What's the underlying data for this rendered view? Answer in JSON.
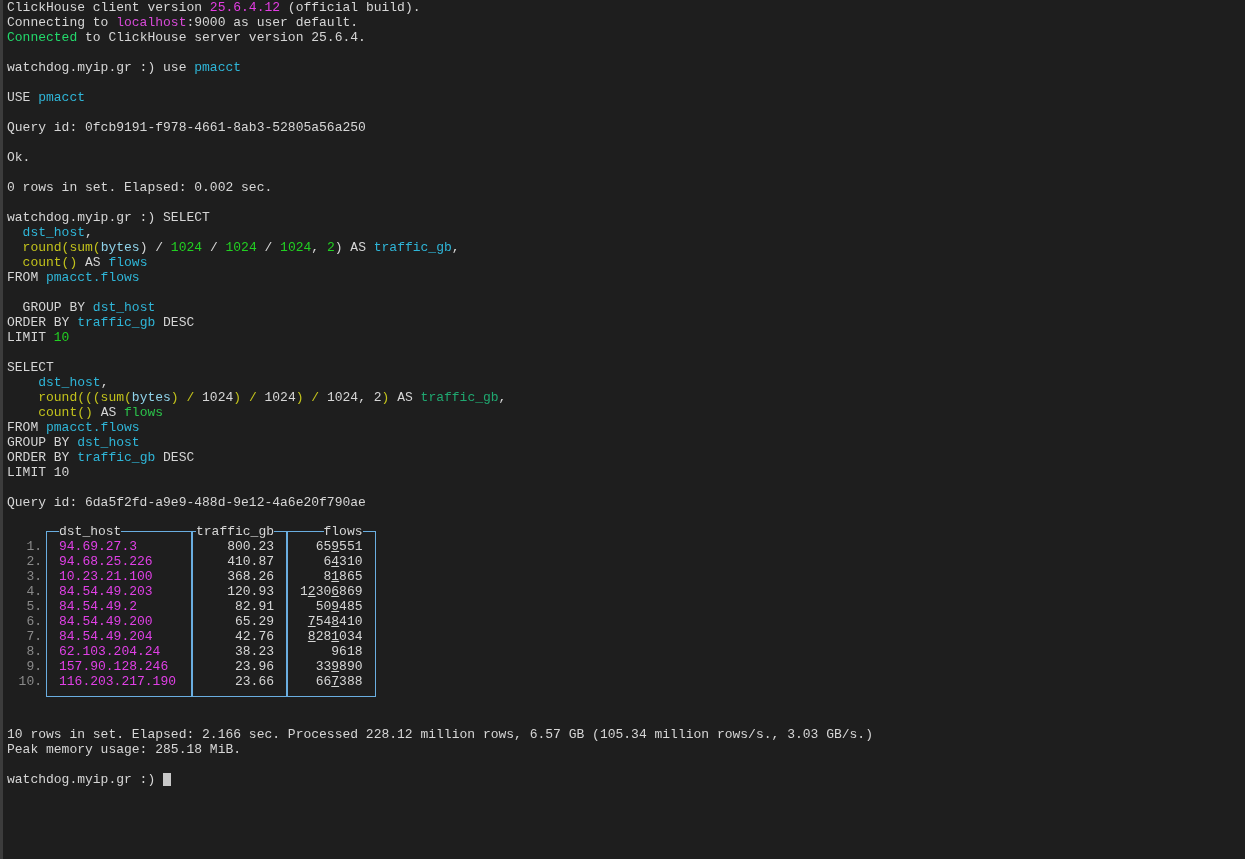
{
  "terminal": {
    "lines_before": [
      {
        "kind": "text",
        "segments": [
          {
            "text": "ClickHouse client version "
          },
          {
            "text": "25.6.4.12",
            "color": "#e23de2"
          },
          {
            "text": " (official build)."
          }
        ]
      },
      {
        "kind": "text",
        "segments": [
          {
            "text": "Connecting to "
          },
          {
            "text": "localhost",
            "color": "#d84ad8"
          },
          {
            "text": ":9000 as user default."
          }
        ]
      },
      {
        "kind": "text",
        "segments": [
          {
            "text": "Connected",
            "color": "#23d86b"
          },
          {
            "text": " to ClickHouse server version 25.6.4."
          }
        ]
      },
      {
        "kind": "blank"
      },
      {
        "kind": "text",
        "segments": [
          {
            "text": "watchdog.myip.gr :) use "
          },
          {
            "text": "pmacct",
            "color": "#2fb6d8"
          }
        ]
      },
      {
        "kind": "blank"
      },
      {
        "kind": "text",
        "segments": [
          {
            "text": "USE "
          },
          {
            "text": "pmacct",
            "color": "#2fb6d8"
          }
        ]
      },
      {
        "kind": "blank"
      },
      {
        "kind": "text",
        "segments": [
          {
            "text": "Query id: 0fcb9191-f978-4661-8ab3-52805a56a250"
          }
        ]
      },
      {
        "kind": "blank"
      },
      {
        "kind": "text",
        "segments": [
          {
            "text": "Ok."
          }
        ]
      },
      {
        "kind": "blank"
      },
      {
        "kind": "text",
        "segments": [
          {
            "text": "0 rows in set. Elapsed: 0.002 sec."
          }
        ]
      },
      {
        "kind": "blank"
      },
      {
        "kind": "text",
        "segments": [
          {
            "text": "watchdog.myip.gr :) SELECT"
          }
        ]
      },
      {
        "kind": "text",
        "segments": [
          {
            "text": "  dst_host",
            "color": "#2fb6d8"
          },
          {
            "text": ","
          }
        ]
      },
      {
        "kind": "text",
        "segments": [
          {
            "text": "  round(sum(",
            "color": "#c2c21c"
          },
          {
            "text": "bytes",
            "color": "#8fd3ea"
          },
          {
            "text": ") / "
          },
          {
            "text": "1024",
            "color": "#22d022"
          },
          {
            "text": " / "
          },
          {
            "text": "1024",
            "color": "#22d022"
          },
          {
            "text": " / "
          },
          {
            "text": "1024",
            "color": "#22d022"
          },
          {
            "text": ", "
          },
          {
            "text": "2",
            "color": "#22d022"
          },
          {
            "text": ") AS "
          },
          {
            "text": "traffic_gb",
            "color": "#2fb6d8"
          },
          {
            "text": ","
          }
        ]
      },
      {
        "kind": "text",
        "segments": [
          {
            "text": "  count()",
            "color": "#c2c21c"
          },
          {
            "text": " AS "
          },
          {
            "text": "flows",
            "color": "#2fb6d8"
          }
        ]
      },
      {
        "kind": "text",
        "segments": [
          {
            "text": "FROM "
          },
          {
            "text": "pmacct.flows",
            "color": "#2fb6d8"
          }
        ]
      },
      {
        "kind": "blank"
      },
      {
        "kind": "text",
        "segments": [
          {
            "text": "  GROUP BY "
          },
          {
            "text": "dst_host",
            "color": "#2fb6d8"
          }
        ]
      },
      {
        "kind": "text",
        "segments": [
          {
            "text": "ORDER BY "
          },
          {
            "text": "traffic_gb",
            "color": "#2fb6d8"
          },
          {
            "text": " DESC"
          }
        ]
      },
      {
        "kind": "text",
        "segments": [
          {
            "text": "LIMIT "
          },
          {
            "text": "10",
            "color": "#22d022"
          }
        ]
      },
      {
        "kind": "blank"
      },
      {
        "kind": "text",
        "segments": [
          {
            "text": "SELECT"
          }
        ]
      },
      {
        "kind": "text",
        "segments": [
          {
            "text": "    dst_host",
            "color": "#2fb6d8"
          },
          {
            "text": ","
          }
        ]
      },
      {
        "kind": "text",
        "segments": [
          {
            "text": "    round(((sum(",
            "color": "#c2c21c"
          },
          {
            "text": "bytes",
            "color": "#8fd3ea"
          },
          {
            "text": ") / ",
            "color": "#c2c21c"
          },
          {
            "text": "1024"
          },
          {
            "text": ") / ",
            "color": "#c2c21c"
          },
          {
            "text": "1024"
          },
          {
            "text": ") / ",
            "color": "#c2c21c"
          },
          {
            "text": "1024, 2"
          },
          {
            "text": ")",
            "color": "#c2c21c"
          },
          {
            "text": " AS "
          },
          {
            "text": "traffic_gb",
            "color": "#1fa870"
          },
          {
            "text": ","
          }
        ]
      },
      {
        "kind": "text",
        "segments": [
          {
            "text": "    count()",
            "color": "#c2c21c"
          },
          {
            "text": " AS "
          },
          {
            "text": "flows",
            "color": "#2bc24a"
          }
        ]
      },
      {
        "kind": "text",
        "segments": [
          {
            "text": "FROM "
          },
          {
            "text": "pmacct.flows",
            "color": "#2fb6d8"
          }
        ]
      },
      {
        "kind": "text",
        "segments": [
          {
            "text": "GROUP BY "
          },
          {
            "text": "dst_host",
            "color": "#2fb6d8"
          }
        ]
      },
      {
        "kind": "text",
        "segments": [
          {
            "text": "ORDER BY "
          },
          {
            "text": "traffic_gb",
            "color": "#2fb6d8"
          },
          {
            "text": " DESC"
          }
        ]
      },
      {
        "kind": "text",
        "segments": [
          {
            "text": "LIMIT 10"
          }
        ]
      },
      {
        "kind": "blank"
      },
      {
        "kind": "text",
        "segments": [
          {
            "text": "Query id: 6da5f2fd-a9e9-488d-9e12-4a6e20f790ae"
          }
        ]
      },
      {
        "kind": "blank"
      }
    ],
    "result_table": {
      "columns": [
        {
          "label": "dst_host"
        },
        {
          "label": "traffic_gb"
        },
        {
          "label": "flows"
        }
      ],
      "rows": [
        {
          "number": "1.",
          "cells": [
            "94.69.27.3",
            "800.23",
            "659551"
          ]
        },
        {
          "number": "2.",
          "cells": [
            "94.68.25.226",
            "410.87",
            "64310"
          ]
        },
        {
          "number": "3.",
          "cells": [
            "10.23.21.100",
            "368.26",
            "81865"
          ]
        },
        {
          "number": "4.",
          "cells": [
            "84.54.49.203",
            "120.93",
            "12306869"
          ]
        },
        {
          "number": "5.",
          "cells": [
            "84.54.49.2",
            "82.91",
            "509485"
          ]
        },
        {
          "number": "6.",
          "cells": [
            "84.54.49.200",
            "65.29",
            "7548410"
          ]
        },
        {
          "number": "7.",
          "cells": [
            "84.54.49.204",
            "42.76",
            "8281034"
          ]
        },
        {
          "number": "8.",
          "cells": [
            "62.103.204.24",
            "38.23",
            "9618"
          ]
        },
        {
          "number": "9.",
          "cells": [
            "157.90.128.246",
            "23.96",
            "339890"
          ]
        },
        {
          "number": "10.",
          "cells": [
            "116.203.217.190",
            "23.66",
            "667388"
          ]
        }
      ]
    },
    "lines_after": [
      {
        "kind": "blank"
      },
      {
        "kind": "blank"
      },
      {
        "kind": "text",
        "segments": [
          {
            "text": "10 rows in set. Elapsed: 2.166 sec. Processed 228.12 million rows, 6.57 GB (105.34 million rows/s., 3.03 GB/s.)"
          }
        ]
      },
      {
        "kind": "text",
        "segments": [
          {
            "text": "Peak memory usage: 285.18 MiB."
          }
        ]
      },
      {
        "kind": "blank"
      },
      {
        "kind": "text",
        "cursor": true,
        "segments": [
          {
            "text": "watchdog.myip.gr :) "
          }
        ]
      }
    ]
  }
}
